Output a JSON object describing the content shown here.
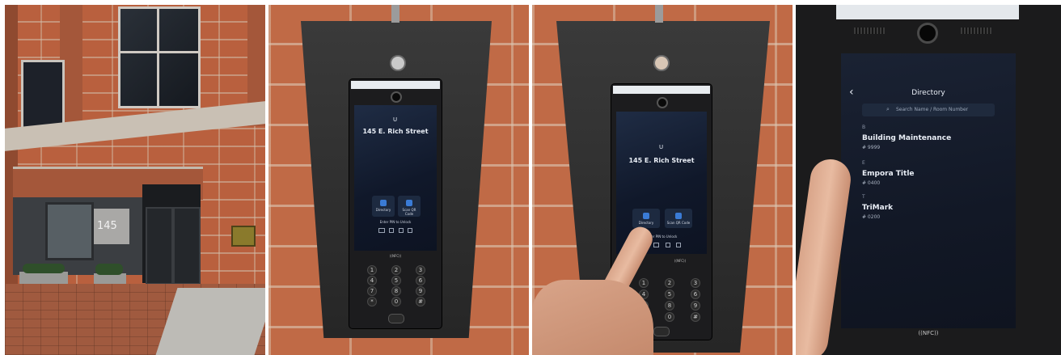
{
  "panels": {
    "building": {
      "sign_number": "145"
    },
    "intercom_home": {
      "address": "145 E. Rich Street",
      "directory_label": "Directory",
      "scan_label": "Scan QR Code",
      "pin_label": "Enter PIN to Unlock",
      "nfc_label": "((NFC))",
      "keypad": [
        "1",
        "2",
        "3",
        "4",
        "5",
        "6",
        "7",
        "8",
        "9",
        "*",
        "0",
        "#"
      ]
    },
    "intercom_press": {
      "address": "145 E. Rich Street",
      "directory_label": "Directory",
      "scan_label": "Scan QR Code",
      "pin_label": "Enter PIN to Unlock",
      "nfc_label": "((NFC))",
      "keypad": [
        "1",
        "2",
        "3",
        "4",
        "5",
        "6",
        "7",
        "8",
        "9",
        "*",
        "0",
        "#"
      ]
    },
    "directory_screen": {
      "back_glyph": "‹",
      "title": "Directory",
      "search_placeholder": "Search Name / Room Number",
      "entries": [
        {
          "letter": "B",
          "name": "Building Maintenance",
          "number": "# 9999"
        },
        {
          "letter": "E",
          "name": "Empora Title",
          "number": "# 0400"
        },
        {
          "letter": "T",
          "name": "TriMark",
          "number": "# 0200"
        }
      ],
      "nfc_label": "((NFC))"
    }
  }
}
